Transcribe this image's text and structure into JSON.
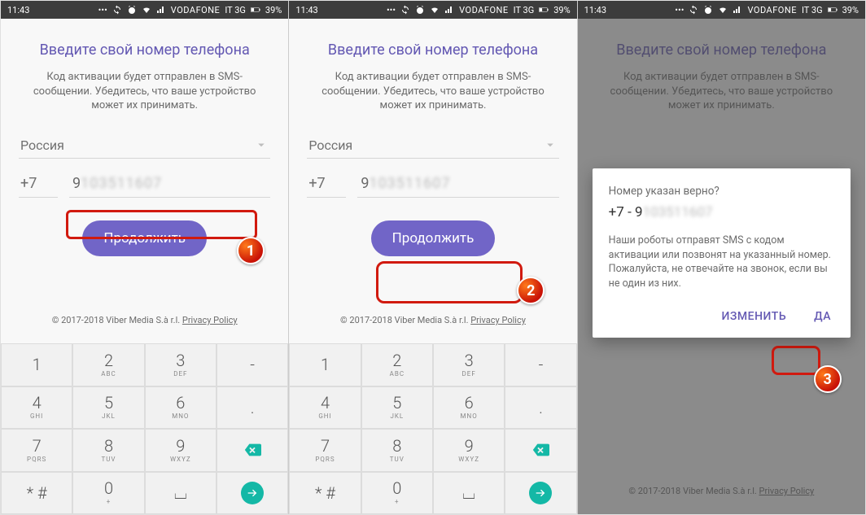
{
  "status": {
    "time": "11:43",
    "carrier": "VODAFONE",
    "network": "IT 3G",
    "battery": "39%"
  },
  "screen": {
    "title": "Введите свой номер телефона",
    "subtitle": "Код активации будет отправлен в SMS-сообщении. Убедитесь, что ваше устройство может их принимать.",
    "country": "Россия",
    "prefix": "+7",
    "number_first": "9",
    "number_rest": "103511607",
    "continue": "Продолжить",
    "footer_pre": "© 2017-2018 Viber Media S.à r.l. ",
    "footer_link": "Privacy Policy"
  },
  "dialog": {
    "question": "Номер указан верно?",
    "number_prefix": "+7 - ",
    "number_first": "9",
    "number_rest": "103511607",
    "info": "Наши роботы отправят SMS с кодом активации или позвонят на указанный номер. Пожалуйста, не отвечайте на звонок, если вы не один из них.",
    "change": "ИЗМЕНИТЬ",
    "yes": "ДА"
  },
  "keypad": [
    {
      "n": "1",
      "l": ""
    },
    {
      "n": "2",
      "l": "ABC"
    },
    {
      "n": "3",
      "l": "DEF"
    },
    {
      "n": "-",
      "l": "",
      "action": "dash"
    },
    {
      "n": "4",
      "l": "GHI"
    },
    {
      "n": "5",
      "l": "JKL"
    },
    {
      "n": "6",
      "l": "MNO"
    },
    {
      "n": ".",
      "l": "",
      "action": "dot"
    },
    {
      "n": "7",
      "l": "PQRS"
    },
    {
      "n": "8",
      "l": "TUV"
    },
    {
      "n": "9",
      "l": "WXYZ"
    },
    {
      "action": "back"
    },
    {
      "n": "* #",
      "l": ""
    },
    {
      "n": "0",
      "l": "+"
    },
    {
      "n": "⌴",
      "l": ""
    },
    {
      "action": "go"
    }
  ],
  "badges": {
    "s1": "1",
    "s2": "2",
    "s3": "3"
  }
}
